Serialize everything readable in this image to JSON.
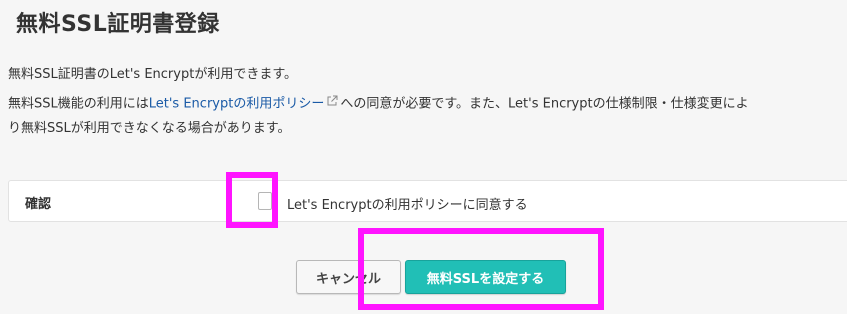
{
  "page": {
    "title": "無料SSL証明書登録"
  },
  "description": {
    "line1": "無料SSL証明書のLet's Encryptが利用できます。",
    "line2_prefix": "無料SSL機能の利用には",
    "line2_link": "Let's Encryptの利用ポリシー",
    "line2_suffix": "への同意が必要です。また、Let's Encryptの仕様制限・仕様変更によ",
    "line3": "り無料SSLが利用できなくなる場合があります。"
  },
  "confirm": {
    "label": "確認",
    "checkbox_label": "Let's Encryptの利用ポリシーに同意する",
    "checked": false
  },
  "buttons": {
    "cancel_label": "キャンセル",
    "submit_label": "無料SSLを設定する"
  },
  "colors": {
    "link": "#1a5aa6",
    "primary_button": "#21bfb6",
    "highlight": "#ff14ff"
  }
}
